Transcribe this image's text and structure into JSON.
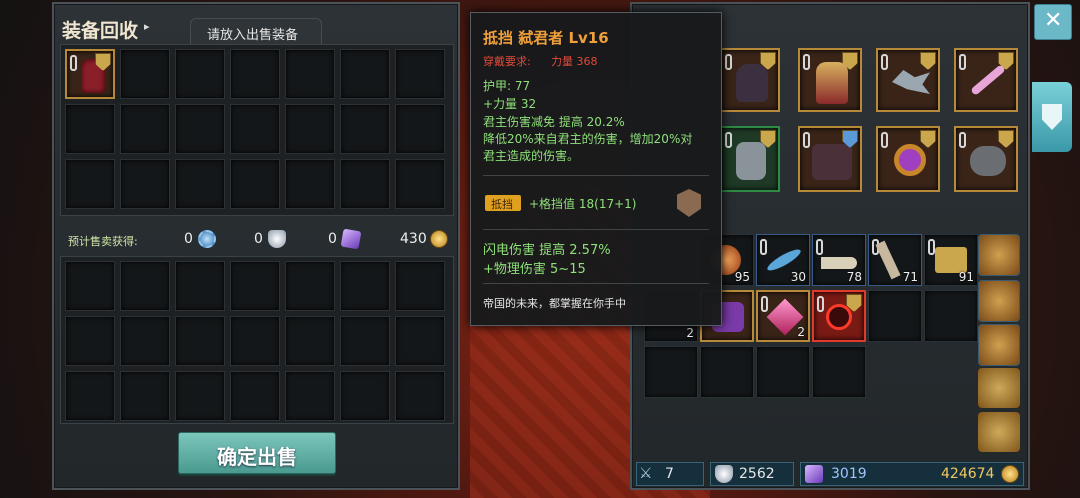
{
  "close_label": "✕",
  "left_panel": {
    "title": "装备回收",
    "title_arrow": "▸",
    "tab_label": "请放入出售装备",
    "earnings_label": "预计售卖获得:",
    "earnings": [
      {
        "value": "0",
        "icon": "blue-gear-icon",
        "color": "#5aa0d6"
      },
      {
        "value": "0",
        "icon": "silver-crest-icon",
        "color": "#b8c6d4"
      },
      {
        "value": "0",
        "icon": "purple-gem-icon",
        "color": "#9a6ad8"
      },
      {
        "value": "430",
        "icon": "gold-coin-icon",
        "color": "#d4a03a"
      }
    ],
    "confirm_button": "确定出售"
  },
  "tooltip": {
    "name": "抵挡 弑君者 Lv16",
    "requirement_label": "穿戴要求:",
    "requirement_value": "力量 368",
    "stats": [
      "护甲:  77",
      "+力量 32",
      "君主伤害减免 提高 20.2%",
      "降低20%来自君主的伤害，增加20%对",
      "君主造成的伤害。"
    ],
    "block_tag": "抵挡",
    "block_value": "+格挡值 18(17+1)",
    "extra_stats": [
      "闪电伤害 提高 2.57%",
      "+物理伤害 5~15"
    ],
    "flavor": "帝国的未来，都掌握在你手中"
  },
  "inventory": {
    "quantities": [
      "95",
      "30",
      "78",
      "71",
      "91",
      "2",
      "2"
    ]
  },
  "currency_bar": [
    {
      "value": "7",
      "icon": "sword-icon"
    },
    {
      "value": "2562",
      "icon": "silver-crest-icon"
    },
    {
      "value": "3019",
      "icon": "purple-gem-icon"
    },
    {
      "value": "424674",
      "icon": "gold-coin-icon"
    }
  ],
  "colors": {
    "tooltip_title": "#f0a03a",
    "requirement": "#e04a3a",
    "stat_green": "#8fe07a",
    "confirm_button": "#5fb0a6"
  }
}
